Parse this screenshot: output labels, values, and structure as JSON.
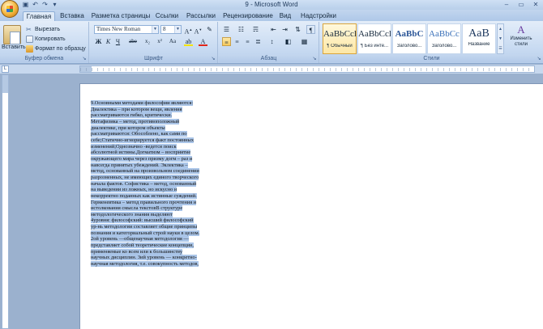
{
  "window": {
    "title": "9 - Microsoft Word",
    "controls": [
      "–",
      "▭",
      "✕"
    ]
  },
  "quick_access": [
    "save-icon",
    "undo-icon",
    "redo-icon",
    "customize-icon"
  ],
  "tabs": [
    {
      "label": "Главная",
      "active": true
    },
    {
      "label": "Вставка"
    },
    {
      "label": "Разметка страницы"
    },
    {
      "label": "Ссылки"
    },
    {
      "label": "Рассылки"
    },
    {
      "label": "Рецензирование"
    },
    {
      "label": "Вид"
    },
    {
      "label": "Надстройки"
    }
  ],
  "ribbon": {
    "clipboard": {
      "label": "Буфер обмена",
      "paste": "Вставить",
      "cut": "Вырезать",
      "copy": "Копировать",
      "format_painter": "Формат по образцу"
    },
    "font": {
      "label": "Шрифт",
      "font_name": "Times New Roman",
      "font_size": "8",
      "buttons": [
        "Ж",
        "К",
        "Ч",
        "abe",
        "x₂",
        "x²",
        "Aa",
        "A"
      ]
    },
    "paragraph": {
      "label": "Абзац"
    },
    "styles": {
      "label": "Стили",
      "tiles": [
        {
          "sample": "AaBbCcl",
          "name": "¶ Обычный",
          "selected": true
        },
        {
          "sample": "AaBbCcl",
          "name": "¶ Без инте..."
        },
        {
          "sample": "AaBbC",
          "name": "Заголово..."
        },
        {
          "sample": "AaBbCc",
          "name": "Заголово..."
        },
        {
          "sample": "AaB",
          "name": "Название"
        }
      ],
      "change_styles": "Изменить стили"
    }
  },
  "document": {
    "lines": [
      "9.Основными методами философии являются:",
      "Диалектика – при котором вещи, явления",
      "рассматриваются гибко, критически.",
      "Метафизика – метод, противоположный",
      "диалектике, при котором объекты",
      "рассматриваются: Обособлено, как сами по",
      "себе;Статично-игнорируется факт постоянных",
      "изменений;Однозначно -ведется поиск",
      "абсолютной истины.Догматизм – восприятие",
      "окружающего мира через призму догм – раз и",
      "навсегда принятых убеждений. Эклектика –",
      "метод, основанный на произвольном соединении",
      "разрозненных, не имеющих единого творческого",
      "начала фактов. Софистика – метод, основанный",
      "на выведении из ложных, но искусно и",
      "некорректно поданных как истинные суждений.",
      "Герменевтика – метод правильного прочтения и",
      "истолкования смысла текстовВ структуре",
      "методологического знания выделяют",
      "4уровня: философский: высший философский",
      "ур-нь методологии составляет общие принципы",
      "познания и категориальный строй науки в целом.",
      "2ой уровень —общенаучная методология —",
      " представляет собой теоретические концепции,",
      "применяемые ко всем или к большинству",
      "научных дисциплин. 3ий уровень — конкретно-",
      "научная методология, т.е. совокупность методов,"
    ]
  }
}
